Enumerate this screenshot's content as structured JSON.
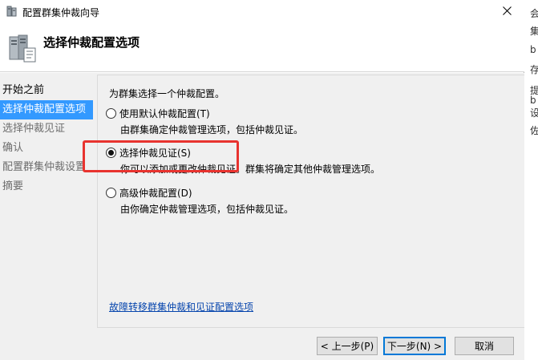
{
  "window": {
    "title": "配置群集仲裁向导"
  },
  "header": {
    "title": "选择仲裁配置选项"
  },
  "nav": {
    "items": [
      {
        "label": "开始之前",
        "state": "done"
      },
      {
        "label": "选择仲裁配置选项",
        "state": "active"
      },
      {
        "label": "选择仲裁见证",
        "state": "pending"
      },
      {
        "label": "确认",
        "state": "pending"
      },
      {
        "label": "配置群集仲裁设置",
        "state": "pending"
      },
      {
        "label": "摘要",
        "state": "pending"
      }
    ]
  },
  "content": {
    "prompt": "为群集选择一个仲裁配置。",
    "options": [
      {
        "label": "使用默认仲裁配置(T)",
        "desc": "由群集确定仲裁管理选项，包括仲裁见证。",
        "checked": false
      },
      {
        "label": "选择仲裁见证(S)",
        "desc": "你可以添加或更改仲裁见证。群集将确定其他仲裁管理选项。",
        "checked": true
      },
      {
        "label": "高级仲裁配置(D)",
        "desc": "由你确定仲裁管理选项，包括仲裁见证。",
        "checked": false
      }
    ],
    "link": "故障转移群集仲裁和见证配置选项"
  },
  "buttons": {
    "back": "< 上一步(P)",
    "next": "下一步(N) >",
    "cancel": "取消"
  },
  "background_strip": [
    "会",
    "集",
    "b",
    "存",
    "提",
    "b",
    "设",
    "佐"
  ],
  "colors": {
    "selection": "#3399ff",
    "highlight_box": "#e8332f",
    "link": "#0645ad"
  }
}
